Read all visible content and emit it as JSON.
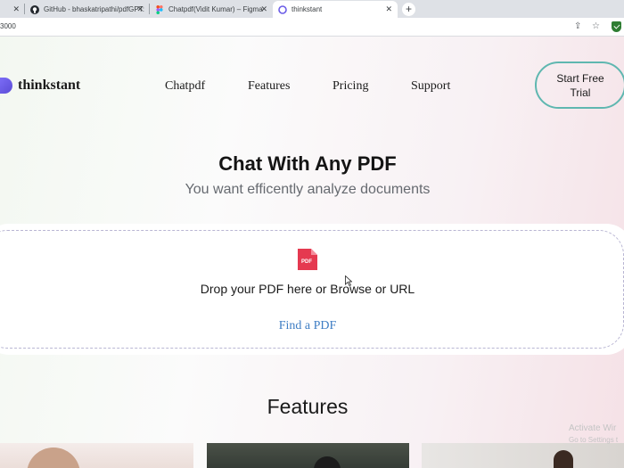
{
  "browser": {
    "tabs": [
      {
        "label": "GitHub - bhaskatripathi/pdfGPT:",
        "active": false
      },
      {
        "label": "Chatpdf(Vidit Kumar) – Figma",
        "active": false
      },
      {
        "label": "thinkstant",
        "active": true
      }
    ],
    "new_tab_symbol": "+",
    "url": "3000"
  },
  "header": {
    "brand": "thinkstant",
    "nav": [
      "Chatpdf",
      "Features",
      "Pricing",
      "Support"
    ],
    "cta_label": "Start Free Trial"
  },
  "hero": {
    "title": "Chat With Any PDF",
    "subtitle": "You want efficently analyze documents"
  },
  "upload": {
    "icon_label": "PDF",
    "drop_text": "Drop your PDF here or Browse or URL",
    "find_link": "Find a PDF"
  },
  "features": {
    "heading": "Features"
  },
  "os_overlay": {
    "line1": "Activate Wir",
    "line2": "Go to Settings t"
  },
  "colors": {
    "accent_outline": "#5fb7b0",
    "link": "#3f7ec4",
    "pdf_icon": "#e53950",
    "logo": "#6b5ce7"
  }
}
